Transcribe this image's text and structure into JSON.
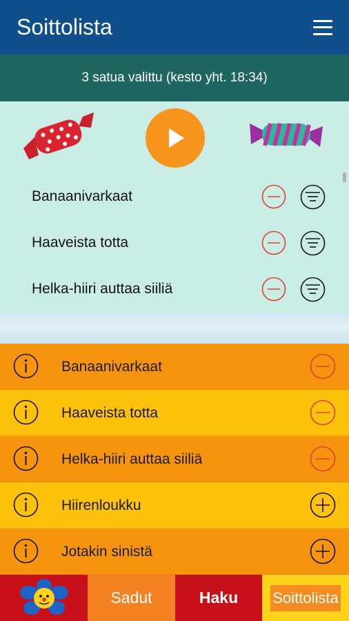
{
  "header": {
    "title": "Soittolista",
    "menu_icon": "hamburger-menu-icon"
  },
  "summary": {
    "text": "3 satua valittu (kesto yht. 18:34)"
  },
  "player": {
    "play_icon": "play-icon",
    "playlist": [
      {
        "label": "Banaanivarkaat"
      },
      {
        "label": "Haaveista totta"
      },
      {
        "label": "Helka-hiiri auttaa siiliä"
      }
    ]
  },
  "stories": [
    {
      "label": "Banaanivarkaat",
      "action": "remove",
      "bg": "#f6930f"
    },
    {
      "label": "Haaveista totta",
      "action": "remove",
      "bg": "#fcc10b"
    },
    {
      "label": "Helka-hiiri auttaa siiliä",
      "action": "remove",
      "bg": "#f6930f"
    },
    {
      "label": "Hiirenloukku",
      "action": "add",
      "bg": "#fcc10b"
    },
    {
      "label": "Jotakin sinistä",
      "action": "add",
      "bg": "#f6930f"
    }
  ],
  "nav": {
    "sadut": "Sadut",
    "haku": "Haku",
    "soittolista": "Soittolista"
  },
  "colors": {
    "appbar": "#0e4f8c",
    "summary": "#1f6560",
    "player_bg": "#c9ede4",
    "accent_orange": "#f7941d",
    "remove_red": "#e2402b",
    "nav_red": "#c8101a",
    "nav_yellow": "#ffd21b"
  }
}
